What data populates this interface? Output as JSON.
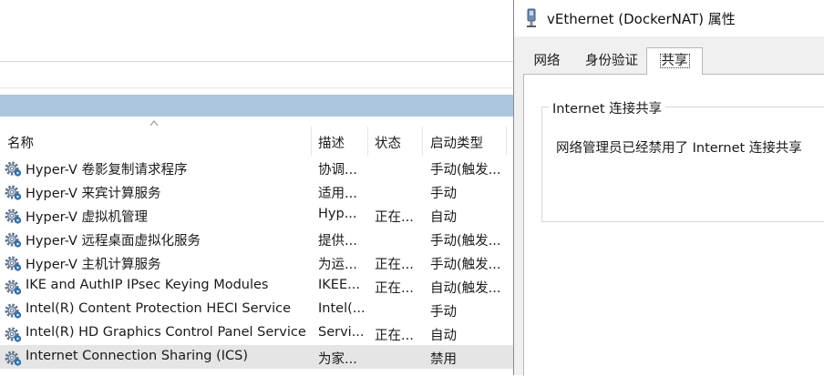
{
  "services": {
    "columns": [
      "名称",
      "描述",
      "状态",
      "启动类型"
    ],
    "rows": [
      {
        "name": "Hyper-V 卷影复制请求程序",
        "desc": "协调...",
        "status": "",
        "startup": "手动(触发..."
      },
      {
        "name": "Hyper-V 来宾计算服务",
        "desc": "适用...",
        "status": "",
        "startup": "手动"
      },
      {
        "name": "Hyper-V 虚拟机管理",
        "desc": "Hyp...",
        "status": "正在...",
        "startup": "自动"
      },
      {
        "name": "Hyper-V 远程桌面虚拟化服务",
        "desc": "提供...",
        "status": "",
        "startup": "手动(触发..."
      },
      {
        "name": "Hyper-V 主机计算服务",
        "desc": "为运...",
        "status": "正在...",
        "startup": "手动(触发..."
      },
      {
        "name": "IKE and AuthIP IPsec Keying Modules",
        "desc": "IKEE...",
        "status": "正在...",
        "startup": "自动(触发..."
      },
      {
        "name": "Intel(R) Content Protection HECI Service",
        "desc": "Intel(...",
        "status": "",
        "startup": "手动"
      },
      {
        "name": "Intel(R) HD Graphics Control Panel Service",
        "desc": "Servi...",
        "status": "正在...",
        "startup": "自动"
      },
      {
        "name": "Internet Connection Sharing (ICS)",
        "desc": "为家...",
        "status": "",
        "startup": "禁用"
      }
    ],
    "selected_row": "Internet Connection Sharing (ICS)"
  },
  "dialog": {
    "title": "vEthernet (DockerNAT) 属性",
    "tabs": [
      "网络",
      "身份验证",
      "共享"
    ],
    "active_tab": "共享",
    "group_title": "Internet 连接共享",
    "message": "网络管理员已经禁用了 Internet 连接共享"
  },
  "colors": {
    "header_bar": "#adc6e0",
    "selected_row": "#e5e5e5",
    "dialog_bg": "#f0f0f0",
    "gear_icon": "#3c7fc0"
  }
}
